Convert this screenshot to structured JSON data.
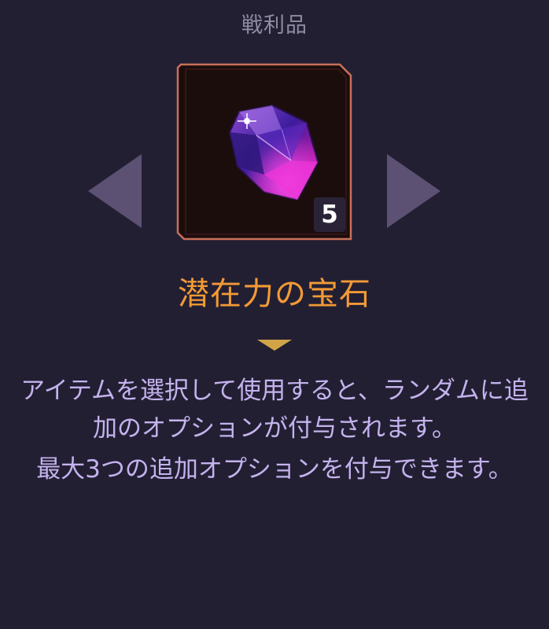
{
  "header": {
    "title": "戦利品"
  },
  "navigation": {
    "prev_icon": "triangle-left",
    "next_icon": "triangle-right"
  },
  "item": {
    "icon": "purple-gem",
    "count": "5",
    "name": "潜在力の宝石"
  },
  "description": {
    "paragraph_1": "アイテムを選択して使用すると、ランダムに追加のオプションが付与されます。",
    "paragraph_2": "最大3つの追加オプションを付与できます。"
  },
  "colors": {
    "background": "#231f33",
    "item_name": "#f29a35",
    "description_text": "#c4b3ee",
    "frame_border": "#c8705a",
    "divider_gold": "#c9983e"
  }
}
